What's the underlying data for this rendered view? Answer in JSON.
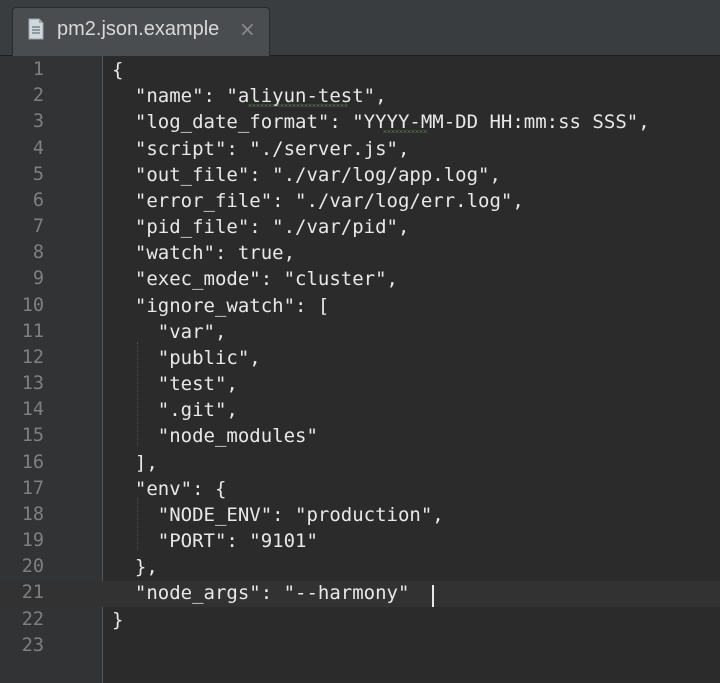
{
  "tab": {
    "title": "pm2.json.example",
    "close_glyph": "×",
    "icon": "file-icon"
  },
  "gutter": {
    "line_numbers": [
      "1",
      "2",
      "3",
      "4",
      "5",
      "6",
      "7",
      "8",
      "9",
      "10",
      "11",
      "12",
      "13",
      "14",
      "15",
      "16",
      "17",
      "18",
      "19",
      "20",
      "21",
      "22",
      "23"
    ]
  },
  "code": {
    "lines": [
      "{",
      "  \"name\": \"aliyun-test\",",
      "  \"log_date_format\": \"YYYY-MM-DD HH:mm:ss SSS\",",
      "  \"script\": \"./server.js\",",
      "  \"out_file\": \"./var/log/app.log\",",
      "  \"error_file\": \"./var/log/err.log\",",
      "  \"pid_file\": \"./var/pid\",",
      "  \"watch\": true,",
      "  \"exec_mode\": \"cluster\",",
      "  \"ignore_watch\": [",
      "    \"var\",",
      "    \"public\",",
      "    \"test\",",
      "    \".git\",",
      "    \"node_modules\"",
      "  ],",
      "  \"env\": {",
      "    \"NODE_ENV\": \"production\",",
      "    \"PORT\": \"9101\"",
      "  },",
      "  \"node_args\": \"--harmony\"",
      "}",
      ""
    ],
    "current_line": 21
  },
  "colors": {
    "background": "#2b2b2b",
    "gutter": "#313335",
    "text": "#e8e8e8",
    "line_number": "#7e8080",
    "typo_underline": "#6a9a5a"
  }
}
